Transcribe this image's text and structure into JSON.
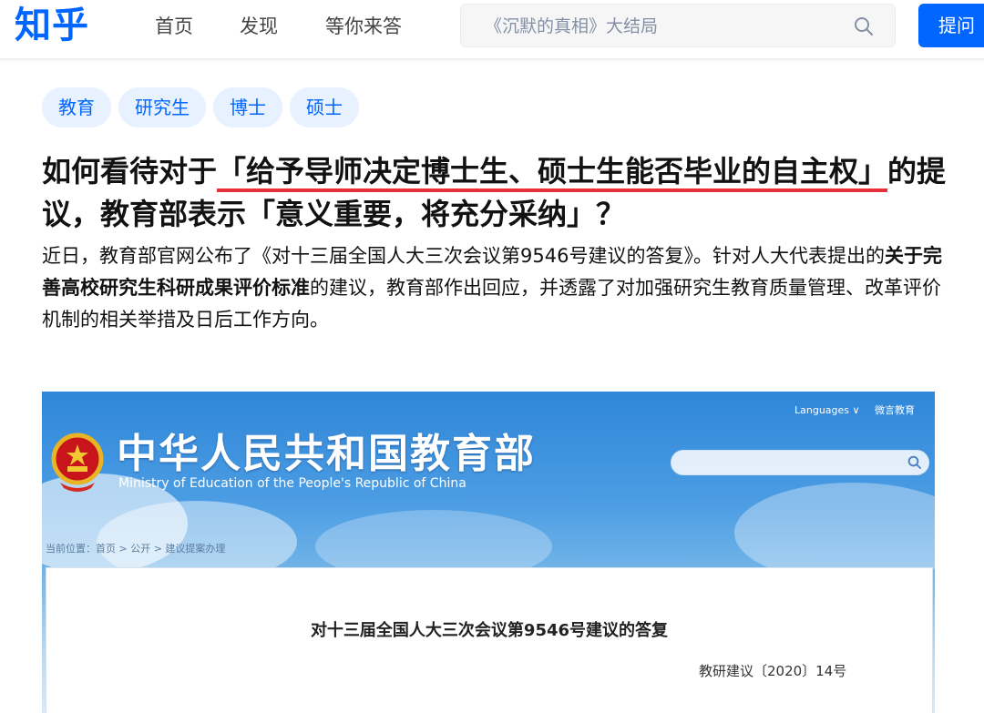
{
  "header": {
    "logo": "知乎",
    "nav": [
      "首页",
      "发现",
      "等你来答"
    ],
    "search_placeholder": "《沉默的真相》大结局",
    "ask_label": "提问"
  },
  "tags": [
    "教育",
    "研究生",
    "博士",
    "硕士"
  ],
  "question": {
    "title_prefix": "如何看待对于",
    "title_highlight": "「给予导师决定博士生、硕士生能否毕业的自主权」",
    "title_suffix": "的提议，教育部表示「意义重要，将充分采纳」？"
  },
  "detail": {
    "part1": "近日，教育部官网公布了《对十三届全国人大三次会议第9546号建议的答复》。针对人大代表提出的",
    "bold": "关于完善高校研究生科研成果评价标准",
    "part2": "的建议，教育部作出回应，并透露了对加强研究生教育质量管理、改革评价机制的相关举措及日后工作方向。"
  },
  "embedded_image": {
    "site_title": "中华人民共和国教育部",
    "site_subtitle": "Ministry of Education of the People's Republic of China",
    "languages": "Languages ∨",
    "wechat": "微言教育",
    "breadcrumb": "当前位置：首页 > 公开 > 建议提案办理",
    "doc_title": "对十三届全国人大三次会议第9546号建议的答复",
    "doc_number": "教研建议〔2020〕14号"
  },
  "colors": {
    "brand": "#0066ff",
    "underline": "#e8313a"
  }
}
